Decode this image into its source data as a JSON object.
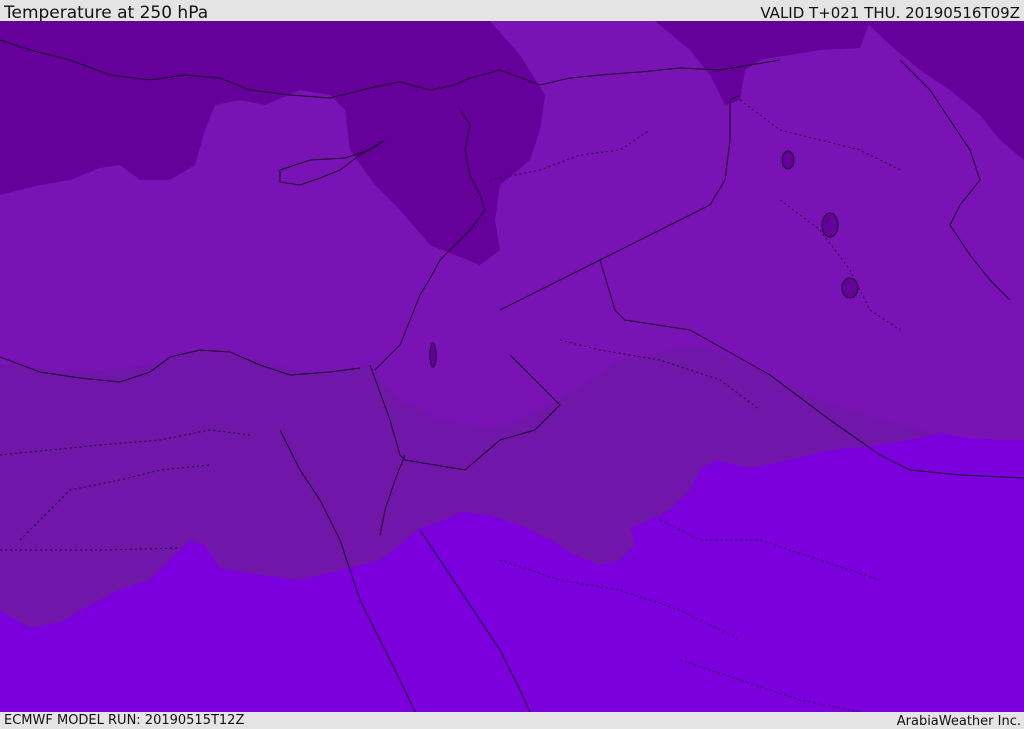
{
  "header": {
    "title": "Temperature at 250 hPa",
    "valid_time": "VALID T+021 THU. 20190516T09Z"
  },
  "footer": {
    "model_run": "ECMWF MODEL RUN: 20190515T12Z",
    "credit": "ArabiaWeather Inc."
  },
  "colors": {
    "band_coldest": "#65009a",
    "band_mid": "#7a13b5",
    "band_warm": "#7016a8",
    "band_warmest": "#7b00dd",
    "boundary_lines": "#1a0028"
  }
}
